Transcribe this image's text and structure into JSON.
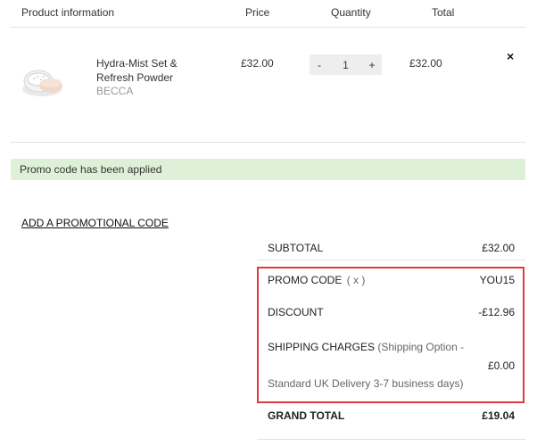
{
  "table": {
    "headers": [
      "Product information",
      "Price",
      "Quantity",
      "Total"
    ]
  },
  "item": {
    "name": "Hydra-Mist Set & Refresh Powder",
    "brand": "BECCA",
    "price": "£32.00",
    "quantity": "1",
    "minus": "-",
    "plus": "+",
    "total": "£32.00",
    "remove": "×"
  },
  "promo_banner": "Promo code has been applied",
  "add_promo_link": "ADD A PROMOTIONAL CODE",
  "summary": {
    "subtotal_label": "SUBTOTAL",
    "subtotal_value": "£32.00",
    "promo_label": "PROMO CODE",
    "promo_remove": "( x )",
    "promo_value": "YOU15",
    "discount_label": "DISCOUNT",
    "discount_value": "-£12.96",
    "shipping_label": "SHIPPING CHARGES",
    "shipping_option_a": "(Shipping Option -",
    "shipping_option_b": "Standard UK Delivery 3-7 business days)",
    "shipping_value": "£0.00",
    "grand_total_label": "GRAND TOTAL",
    "grand_total_value": "£19.04"
  },
  "colors": {
    "highlight_border": "#e03a3e",
    "banner_background": "#dff0d8"
  }
}
